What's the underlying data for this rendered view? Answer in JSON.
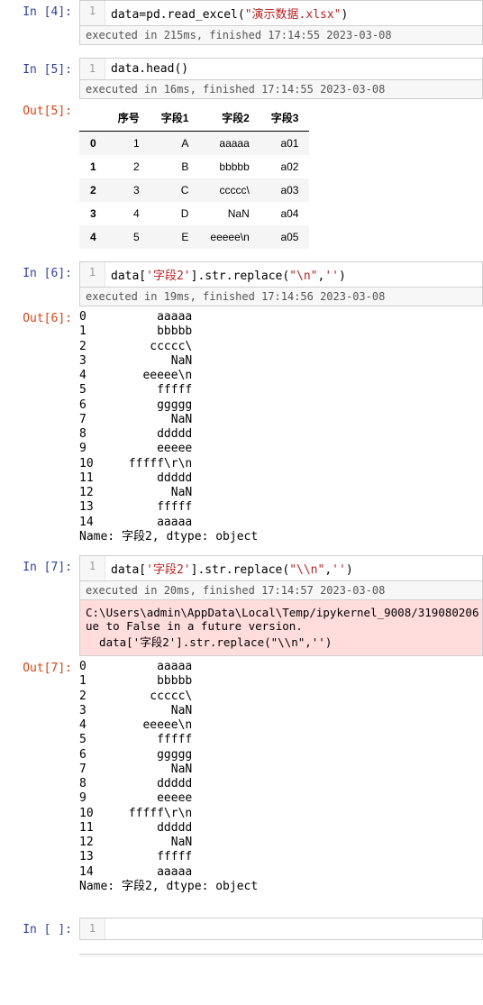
{
  "cells": {
    "c4": {
      "prompt": "In [4]:",
      "ln": "1",
      "code_pre": "data=pd.read_excel(",
      "code_str": "\"演示数据.xlsx\"",
      "code_post": ")",
      "timing": "executed in 215ms, finished 17:14:55 2023-03-08"
    },
    "c5": {
      "prompt": "In [5]:",
      "ln": "1",
      "code": "data.head()",
      "timing": "executed in 16ms, finished 17:14:55 2023-03-08",
      "out_prompt": "Out[5]:"
    },
    "table5": {
      "headers": [
        "",
        "序号",
        "字段1",
        "字段2",
        "字段3"
      ],
      "rows": [
        [
          "0",
          "1",
          "A",
          "aaaaa",
          "a01"
        ],
        [
          "1",
          "2",
          "B",
          "bbbbb",
          "a02"
        ],
        [
          "2",
          "3",
          "C",
          "ccccc\\",
          "a03"
        ],
        [
          "3",
          "4",
          "D",
          "NaN",
          "a04"
        ],
        [
          "4",
          "5",
          "E",
          "eeeee\\n",
          "a05"
        ]
      ]
    },
    "c6": {
      "prompt": "In [6]:",
      "ln": "1",
      "code_pre": "data[",
      "code_str1": "'字段2'",
      "code_mid": "].str.replace(",
      "code_str2": "\"\\n\"",
      "code_sep": ",",
      "code_str3": "''",
      "code_post": ")",
      "timing": "executed in 19ms, finished 17:14:56 2023-03-08",
      "out_prompt": "Out[6]:"
    },
    "series": {
      "indices": [
        "0",
        "1",
        "2",
        "3",
        "4",
        "5",
        "6",
        "7",
        "8",
        "9",
        "10",
        "11",
        "12",
        "13",
        "14"
      ],
      "values": [
        "aaaaa",
        "bbbbb",
        "ccccc\\",
        "NaN",
        "eeeee\\n",
        "fffff",
        "ggggg",
        "NaN",
        "ddddd",
        "eeeee",
        "fffff\\r\\n",
        "ddddd",
        "NaN",
        "fffff",
        "aaaaa"
      ],
      "footer": "Name: 字段2, dtype: object"
    },
    "c7": {
      "prompt": "In [7]:",
      "ln": "1",
      "code_pre": "data[",
      "code_str1": "'字段2'",
      "code_mid": "].str.replace(",
      "code_str2": "\"\\\\n\"",
      "code_sep": ",",
      "code_str3": "''",
      "code_post": ")",
      "timing": "executed in 20ms, finished 17:14:57 2023-03-08",
      "out_prompt": "Out[7]:",
      "stderr_l1": "C:\\Users\\admin\\AppData\\Local\\Temp/ipykernel_9008/319080206",
      "stderr_l2": "ue to False in a future version.",
      "stderr_l3": "  data['字段2'].str.replace(\"\\\\n\",'')"
    },
    "cEmpty": {
      "prompt": "In [ ]:",
      "ln": "1"
    }
  }
}
